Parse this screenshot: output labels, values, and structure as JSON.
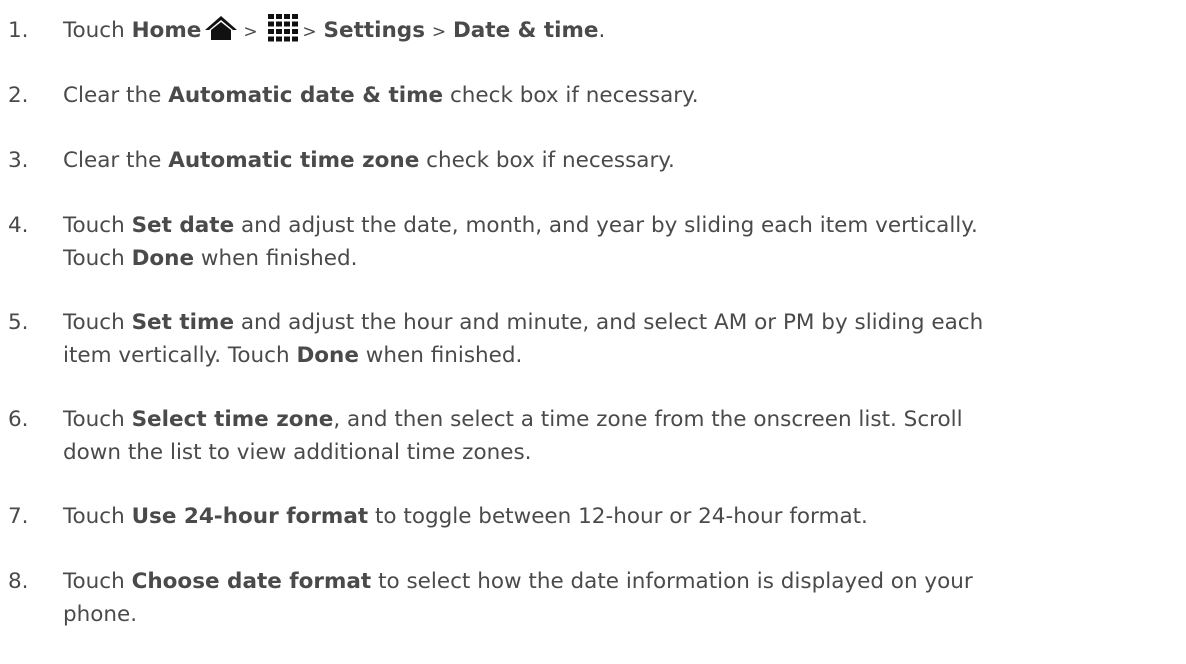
{
  "icons": {
    "home": "home-icon",
    "apps": "apps-grid-icon"
  },
  "steps": [
    {
      "num": "1.",
      "touch": "Touch",
      "home": "Home",
      "sep1": ">",
      "sep2": ">",
      "settings": "Settings",
      "sep3": ">",
      "datetime": "Date & time",
      "end": "."
    },
    {
      "num": "2.",
      "pre": "Clear the",
      "bold": "Automatic date & time",
      "post": "check box if necessary."
    },
    {
      "num": "3.",
      "pre": "Clear the",
      "bold": "Automatic time zone",
      "post": "check box if necessary."
    },
    {
      "num": "4.",
      "pre": "Touch",
      "bold": "Set date",
      "post": "and adjust the date, month, and year by sliding each item vertically.",
      "line2_pre": "Touch",
      "line2_bold": "Done",
      "line2_post": "when finished."
    },
    {
      "num": "5.",
      "pre": "Touch",
      "bold": "Set time",
      "post": "and adjust the hour and minute, and select AM or PM by sliding each",
      "line2_pre": "item vertically. Touch",
      "line2_bold": "Done",
      "line2_post": "when finished."
    },
    {
      "num": "6.",
      "pre": "Touch",
      "bold": "Select time zone",
      "post": ", and then select a time zone from the onscreen list. Scroll",
      "line2": "down the list to view additional time zones."
    },
    {
      "num": "7.",
      "pre": "Touch",
      "bold": "Use 24-hour format",
      "post": "to toggle between 12-hour or 24-hour format."
    },
    {
      "num": "8.",
      "pre": "Touch",
      "bold": "Choose date format",
      "post": "to select how the date information is displayed on your",
      "line2": "phone."
    }
  ]
}
